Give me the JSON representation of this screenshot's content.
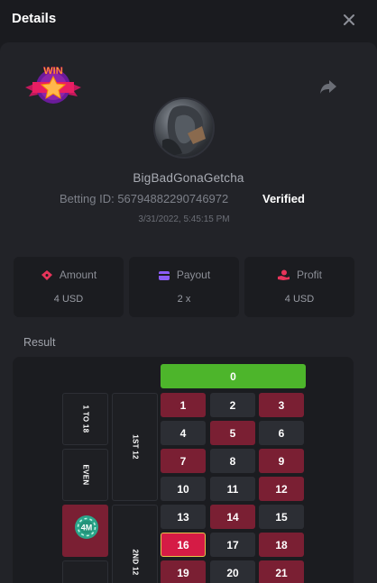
{
  "header": {
    "title": "Details"
  },
  "badge": {
    "text": "WIN"
  },
  "player": {
    "username": "BigBadGonaGetcha"
  },
  "bet": {
    "id_label": "Betting ID:",
    "id_value": "56794882290746972",
    "status": "Verified",
    "datetime": "3/31/2022, 5:45:15 PM"
  },
  "stats": [
    {
      "label": "Amount",
      "value": "4 USD",
      "icon": "ticket-icon",
      "color": "#e8345a"
    },
    {
      "label": "Payout",
      "value": "2 x",
      "icon": "wallet-icon",
      "color": "#8b5cf6"
    },
    {
      "label": "Profit",
      "value": "4 USD",
      "icon": "hand-coin-icon",
      "color": "#e8345a"
    }
  ],
  "result": {
    "label": "Result",
    "zero": "0",
    "side_bets": [
      "1 TO 18",
      "EVEN",
      "1ST 12",
      "2ND 12"
    ],
    "chip_label": "4M",
    "rows": [
      [
        {
          "n": "1",
          "c": "red"
        },
        {
          "n": "2",
          "c": "black"
        },
        {
          "n": "3",
          "c": "red"
        }
      ],
      [
        {
          "n": "4",
          "c": "black"
        },
        {
          "n": "5",
          "c": "red"
        },
        {
          "n": "6",
          "c": "black"
        }
      ],
      [
        {
          "n": "7",
          "c": "red"
        },
        {
          "n": "8",
          "c": "black"
        },
        {
          "n": "9",
          "c": "red"
        }
      ],
      [
        {
          "n": "10",
          "c": "black"
        },
        {
          "n": "11",
          "c": "black"
        },
        {
          "n": "12",
          "c": "red"
        }
      ],
      [
        {
          "n": "13",
          "c": "black"
        },
        {
          "n": "14",
          "c": "red"
        },
        {
          "n": "15",
          "c": "black"
        }
      ],
      [
        {
          "n": "16",
          "c": "sel"
        },
        {
          "n": "17",
          "c": "black"
        },
        {
          "n": "18",
          "c": "red"
        }
      ],
      [
        {
          "n": "19",
          "c": "red"
        },
        {
          "n": "20",
          "c": "black"
        },
        {
          "n": "21",
          "c": "red"
        }
      ]
    ]
  },
  "colors": {
    "green": "#4db52b",
    "red": "#7a1f33",
    "black": "#2c2e34",
    "selected": "#d51b45",
    "accent": "#e7c64a"
  }
}
